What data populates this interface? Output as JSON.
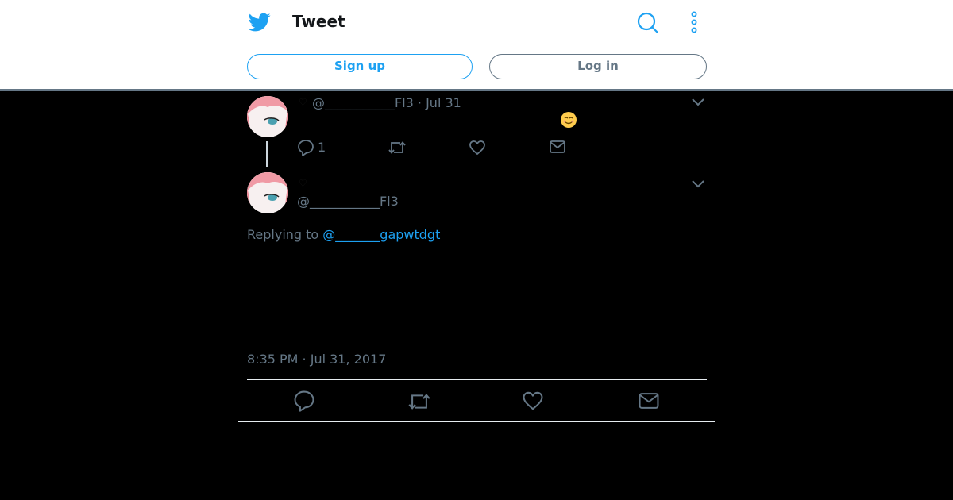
{
  "header": {
    "title": "Tweet",
    "signup_label": "Sign up",
    "login_label": "Log in",
    "icons": [
      "twitter-bird-icon",
      "search-icon",
      "more-options-icon"
    ],
    "accent_color": "#1da1f2"
  },
  "parent_tweet": {
    "handle": "@___________Fl3",
    "date": "Jul 31",
    "handle_date": "@___________Fl3 · Jul 31",
    "reply_count": "1"
  },
  "main_tweet": {
    "handle": "@___________Fl3",
    "replying_prefix": "Replying to ",
    "replying_to": "@_______gapwtdgt",
    "timestamp": "8:35 PM · Jul 31, 2017"
  }
}
